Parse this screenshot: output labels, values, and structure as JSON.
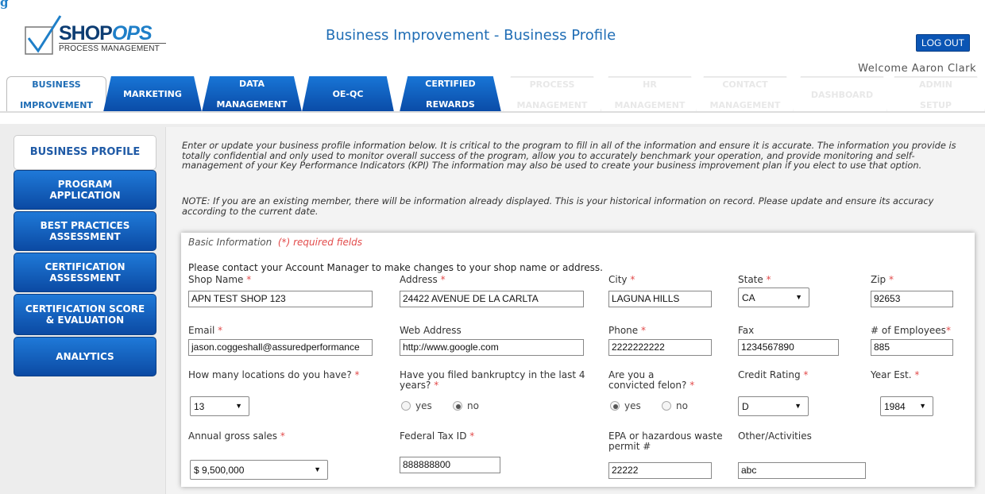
{
  "top_fragment": "g",
  "logo": {
    "brand_part1": "SHOP",
    "brand_part2": "OPS",
    "tagline": "PROCESS MANAGEMENT"
  },
  "header": {
    "title": "Business Improvement - Business Profile",
    "logout_label": "LOG OUT",
    "welcome": "Welcome Aaron Clark"
  },
  "tabs": [
    {
      "line1": "BUSINESS",
      "line2": "IMPROVEMENT"
    },
    {
      "line1": "MARKETING",
      "line2": ""
    },
    {
      "line1": "DATA",
      "line2": "MANAGEMENT"
    },
    {
      "line1": "OE-QC",
      "line2": ""
    },
    {
      "line1": "CERTIFIED",
      "line2": "REWARDS"
    },
    {
      "line1": "PROCESS",
      "line2": "MANAGEMENT"
    },
    {
      "line1": "HR",
      "line2": "MANAGEMENT"
    },
    {
      "line1": "CONTACT",
      "line2": "MANAGEMENT"
    },
    {
      "line1": "DASHBOARD",
      "line2": ""
    },
    {
      "line1": "ADMIN",
      "line2": "SETUP"
    }
  ],
  "sidebar": [
    {
      "line1": "BUSINESS PROFILE",
      "line2": ""
    },
    {
      "line1": "PROGRAM",
      "line2": "APPLICATION"
    },
    {
      "line1": "BEST PRACTICES",
      "line2": "ASSESSMENT"
    },
    {
      "line1": "CERTIFICATION",
      "line2": "ASSESSMENT"
    },
    {
      "line1": "CERTIFICATION SCORE",
      "line2": "& EVALUATION"
    },
    {
      "line1": "ANALYTICS",
      "line2": ""
    }
  ],
  "intro": "Enter or update your business profile information below. It is critical to the program to fill in all of the information and ensure it is accurate. The information you provide is totally confidential and only used to monitor overall success of the program, allow you to accurately benchmark your operation, and provide monitoring and self-management of your Key Performance Indicators (KPI) The information may also be used to create your business improvement plan if you elect to use that option.",
  "note": "NOTE: If you are an existing member, there will be information already displayed. This is your historical information on record. Please update and ensure its accuracy according to the current date.",
  "form": {
    "legend": "Basic Information",
    "legend_req": "(*) required fields",
    "contact_msg": "Please contact your Account Manager to make changes to your shop name or address.",
    "star": "*",
    "shop_name_label": "Shop Name",
    "shop_name": "APN TEST SHOP 123",
    "address_label": "Address",
    "address": "24422 AVENUE DE LA CARLTA",
    "city_label": "City",
    "city": "LAGUNA HILLS",
    "state_label": "State",
    "state": "CA",
    "zip_label": "Zip",
    "zip": "92653",
    "email_label": "Email",
    "email": "jason.coggeshall@assuredperformance",
    "web_label": "Web Address",
    "web": "http://www.google.com",
    "phone_label": "Phone",
    "phone": "2222222222",
    "fax_label": "Fax",
    "fax": "1234567890",
    "employees_label": "# of Employees",
    "employees": "885",
    "locations_label": "How many locations do you have?",
    "locations": "13",
    "bankruptcy_label_1": "Have you filed bankruptcy in the last 4",
    "bankruptcy_label_2": "years?",
    "felon_label_1": "Are you a",
    "felon_label_2": "convicted felon?",
    "yes": "yes",
    "no": "no",
    "credit_label": "Credit Rating",
    "credit": "D",
    "year_label": "Year Est.",
    "year": "1984",
    "sales_label": "Annual gross sales",
    "sales": "$ 9,500,000",
    "taxid_label": "Federal Tax ID",
    "taxid": "888888800",
    "epa_label_1": "EPA or hazardous waste",
    "epa_label_2": "permit #",
    "epa": "22222",
    "other_label": "Other/Activities",
    "other": "abc"
  },
  "radios": {
    "bankruptcy": "no",
    "felon": "yes"
  },
  "colors": {
    "primary_blue": "#0b55b4",
    "title_blue": "#1f6db5",
    "required_red": "#e24b4b"
  }
}
